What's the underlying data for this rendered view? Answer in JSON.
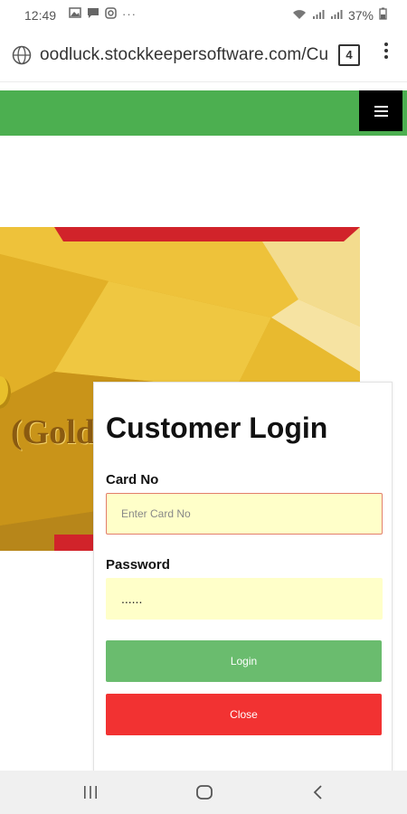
{
  "status_bar": {
    "time": "12:49",
    "battery": "37%",
    "icons": [
      "image-icon",
      "message-icon",
      "instagram-icon",
      "more-icon"
    ]
  },
  "browser": {
    "url": "oodluck.stockkeepersoftware.com/Cu",
    "tab_count": "4"
  },
  "card_banner": {
    "text": "(Gold"
  },
  "login": {
    "title": "Customer Login",
    "card_label": "Card No",
    "card_placeholder": "Enter Card No",
    "password_label": "Password",
    "password_value": "......",
    "login_button": "Login",
    "close_button": "Close"
  },
  "colors": {
    "header_green": "#4caf50",
    "login_button": "#6abc6e",
    "close_button": "#f23232",
    "field_bg": "#ffffc9"
  }
}
